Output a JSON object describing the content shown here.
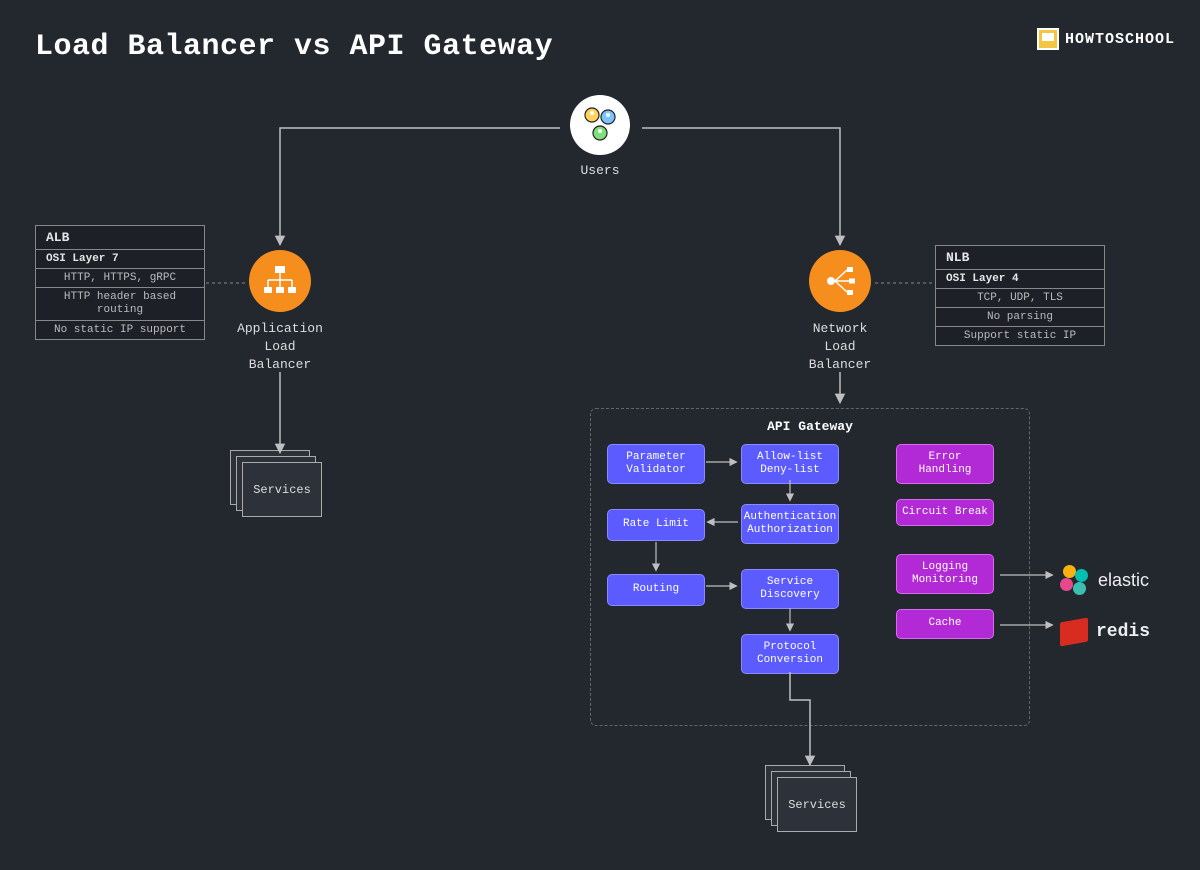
{
  "title": "Load Balancer vs API Gateway",
  "brand": "HOWTOSCHOOL",
  "users_label": "Users",
  "alb": {
    "label_l1": "Application",
    "label_l2": "Load",
    "label_l3": "Balancer",
    "table_header": "ALB",
    "table_subheader": "OSI Layer 7",
    "rows": [
      "HTTP, HTTPS, gRPC",
      "HTTP header based routing",
      "No static IP support"
    ]
  },
  "nlb": {
    "label_l1": "Network",
    "label_l2": "Load",
    "label_l3": "Balancer",
    "table_header": "NLB",
    "table_subheader": "OSI Layer 4",
    "rows": [
      "TCP, UDP, TLS",
      "No parsing",
      "Support static IP"
    ]
  },
  "services_label": "Services",
  "gateway": {
    "title": "API Gateway",
    "boxes": {
      "param_validator": "Parameter Validator",
      "allow_deny": "Allow-list Deny-list",
      "rate_limit": "Rate Limit",
      "auth": "Authentication Authorization",
      "routing": "Routing",
      "service_discovery": "Service Discovery",
      "protocol_conv": "Protocol Conversion",
      "error_handling": "Error Handling",
      "circuit_break": "Circuit Break",
      "logging": "Logging Monitoring",
      "cache": "Cache"
    }
  },
  "external": {
    "elastic": "elastic",
    "redis": "redis"
  }
}
